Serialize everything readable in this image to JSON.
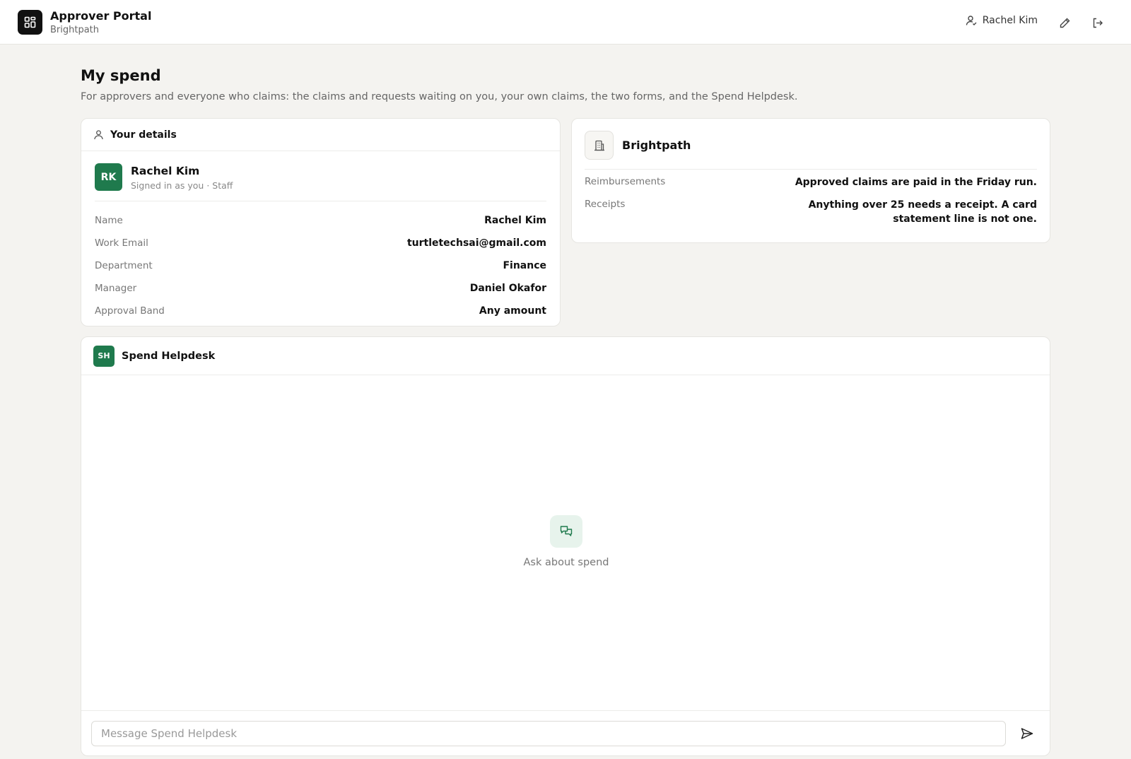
{
  "header": {
    "app_title": "Approver Portal",
    "org_subtitle": "Brightpath",
    "user_name": "Rachel Kim",
    "icons": [
      "grid-icon",
      "user-icon",
      "pencil-icon",
      "logout-icon"
    ]
  },
  "page": {
    "title": "My spend",
    "description": "For approvers and everyone who claims: the claims and requests waiting on you, your own claims, the two forms, and the Spend Helpdesk."
  },
  "details": {
    "heading": "Your details",
    "avatar_initials": "RK",
    "name": "Rachel Kim",
    "role_line": "Signed in as you · Staff",
    "rows": [
      {
        "label": "Name",
        "value": "Rachel Kim"
      },
      {
        "label": "Work Email",
        "value": "turtletechsai@gmail.com"
      },
      {
        "label": "Department",
        "value": "Finance"
      },
      {
        "label": "Manager",
        "value": "Daniel Okafor"
      },
      {
        "label": "Approval Band",
        "value": "Any amount"
      }
    ]
  },
  "org": {
    "name": "Brightpath",
    "rows": [
      {
        "label": "Reimbursements",
        "value": "Approved claims are paid in the Friday run."
      },
      {
        "label": "Receipts",
        "value": "Anything over 25 needs a receipt. A card statement line is not one."
      }
    ]
  },
  "helpdesk": {
    "badge": "SH",
    "title": "Spend Helpdesk",
    "empty_text": "Ask about spend",
    "input_placeholder": "Message Spend Helpdesk"
  },
  "colors": {
    "accent": "#1f7a4d",
    "page_bg": "#f4f3f0"
  }
}
